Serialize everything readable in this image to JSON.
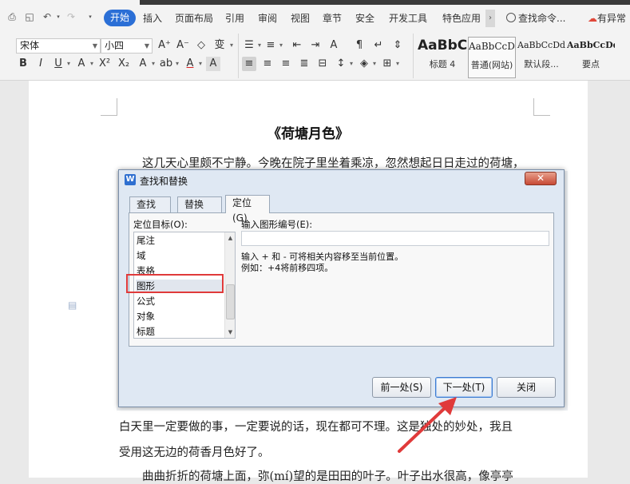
{
  "ribbon": {
    "tabs": [
      "开始",
      "插入",
      "页面布局",
      "引用",
      "审阅",
      "视图",
      "章节",
      "安全",
      "开发工具",
      "特色应用"
    ],
    "active_tab": "开始",
    "command_search": "查找命令...",
    "status_right": "有异常",
    "font_name": "宋体",
    "font_size": "小四",
    "styles": [
      {
        "sample": "AaBbC",
        "name": "标题 4"
      },
      {
        "sample": "AaBbCcDd",
        "name": "普通(网站)"
      },
      {
        "sample": "AaBbCcDd",
        "name": "默认段..."
      },
      {
        "sample": "AaBbCcDd",
        "name": "要点"
      }
    ],
    "accent_color": "#2b6fd6"
  },
  "document": {
    "title": "《荷塘月色》",
    "para1": "这几天心里颇不宁静。今晚在院子里坐着乘凉，忽然想起日日走过的荷塘，",
    "para_after_1": "白天里一定要做的事，一定要说的话，现在都可不理。这是独处的妙处，我且",
    "para_after_2": "受用这无边的荷香月色好了。",
    "para_after_3": "曲曲折折的荷塘上面，弥(mí)望的是田田的叶子。叶子出水很高，像亭亭"
  },
  "dialog": {
    "title": "查找和替换",
    "close_glyph": "✕",
    "tabs": [
      "查找(D)",
      "替换(P)",
      "定位(G)"
    ],
    "active_tab": "定位(G)",
    "target_label": "定位目标(O):",
    "targets": [
      "尾注",
      "域",
      "表格",
      "图形",
      "公式",
      "对象",
      "标题"
    ],
    "selected_target": "图形",
    "number_label": "输入图形编号(E):",
    "number_value": "",
    "hint_line1": "输入 + 和 - 可将相关内容移至当前位置。",
    "hint_line2": "例如：+4将前移四项。",
    "buttons": {
      "prev": "前一处(S)",
      "next": "下一处(T)",
      "close": "关闭"
    }
  },
  "annotation_color": "#e03a3a"
}
